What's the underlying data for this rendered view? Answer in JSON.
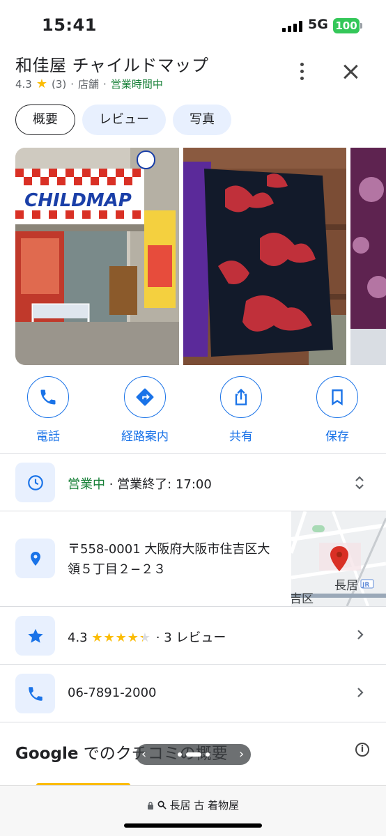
{
  "status_bar": {
    "time": "15:41",
    "network": "5G",
    "battery": "100"
  },
  "place": {
    "title": "和佳屋 チャイルドマップ",
    "rating": "4.3",
    "review_count": "(3)",
    "category": "店舗",
    "open_status": "営業時間中",
    "separator": "·"
  },
  "tabs": [
    {
      "label": "概要",
      "active": true
    },
    {
      "label": "レビュー",
      "active": false
    },
    {
      "label": "写真",
      "active": false
    }
  ],
  "photos": {
    "store_sign": "CHILDMAP"
  },
  "actions": [
    {
      "label": "電話",
      "icon": "phone-icon"
    },
    {
      "label": "経路案内",
      "icon": "directions-icon"
    },
    {
      "label": "共有",
      "icon": "share-icon"
    },
    {
      "label": "保存",
      "icon": "bookmark-icon"
    }
  ],
  "hours": {
    "status": "営業中",
    "detail": " · 営業終了: 17:00"
  },
  "address": {
    "text": "〒558-0001 大阪府大阪市住吉区大領５丁目２−２３",
    "map_label_station": "長居",
    "map_label_area": "吉区",
    "map_badge": "JR"
  },
  "rating_row": {
    "rating": "4.3",
    "stars": 4.3,
    "reviews": "· 3 レビュー"
  },
  "phone": "06-7891-2000",
  "summary": {
    "brand": "Google",
    "title_rest": " でのクチコミの概要",
    "info": "i"
  },
  "url_bar": {
    "text": "長居 古 着物屋"
  },
  "colors": {
    "accent": "#1a73e8",
    "open_green": "#188038",
    "star": "#fbbc04",
    "chip_bg": "#e8f0fe"
  }
}
